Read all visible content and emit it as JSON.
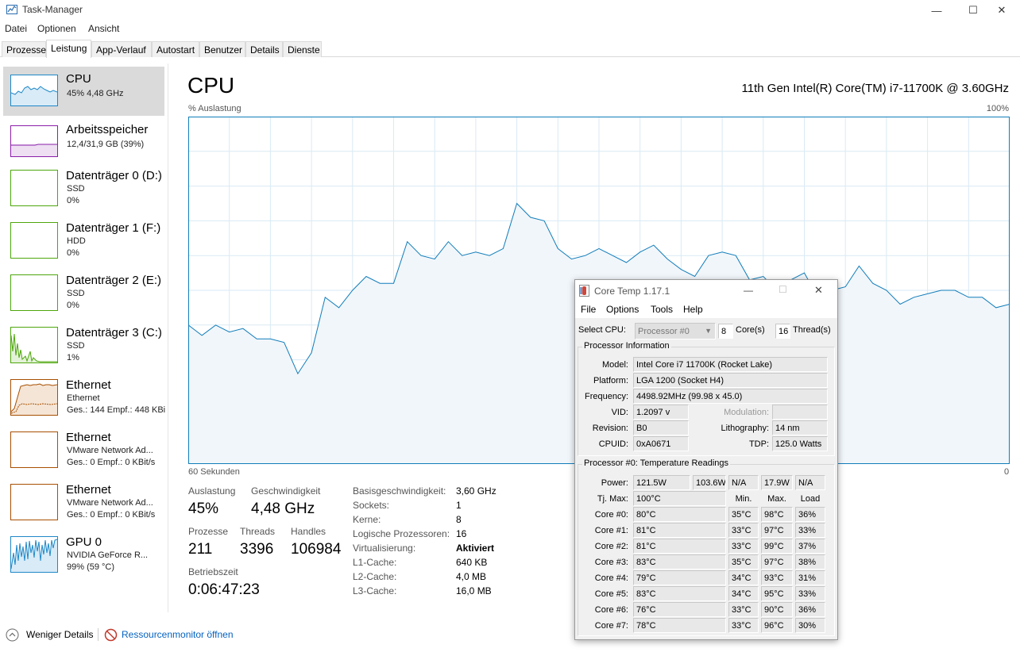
{
  "window": {
    "title": "Task-Manager",
    "minimize_glyph": "—",
    "maximize_glyph": "☐",
    "close_glyph": "✕"
  },
  "menubar": [
    "Datei",
    "Optionen",
    "Ansicht"
  ],
  "tabs": [
    "Prozesse",
    "Leistung",
    "App-Verlauf",
    "Autostart",
    "Benutzer",
    "Details",
    "Dienste"
  ],
  "active_tab": "Leistung",
  "sidebar": [
    {
      "title": "CPU",
      "sub1": "45% 4,48 GHz",
      "sub2": "",
      "color": "#1e88c7",
      "icon": "cpu-graph-icon"
    },
    {
      "title": "Arbeitsspeicher",
      "sub1": "12,4/31,9 GB (39%)",
      "sub2": "",
      "color": "#8b1fa9",
      "icon": "memory-graph-icon"
    },
    {
      "title": "Datenträger 0 (D:)",
      "sub1": "SSD",
      "sub2": "0%",
      "color": "#4da60c",
      "icon": "disk-graph-icon"
    },
    {
      "title": "Datenträger 1 (F:)",
      "sub1": "HDD",
      "sub2": "0%",
      "color": "#4da60c",
      "icon": "disk-graph-icon"
    },
    {
      "title": "Datenträger 2 (E:)",
      "sub1": "SSD",
      "sub2": "0%",
      "color": "#4da60c",
      "icon": "disk-graph-icon"
    },
    {
      "title": "Datenträger 3 (C:)",
      "sub1": "SSD",
      "sub2": "1%",
      "color": "#4da60c",
      "icon": "disk-graph-icon"
    },
    {
      "title": "Ethernet",
      "sub1": "Ethernet",
      "sub2": "Ges.: 144 Empf.: 448 KBi",
      "color": "#a74f01",
      "icon": "network-graph-icon"
    },
    {
      "title": "Ethernet",
      "sub1": "VMware Network Ad...",
      "sub2": "Ges.: 0 Empf.: 0 KBit/s",
      "color": "#a74f01",
      "icon": "network-graph-icon"
    },
    {
      "title": "Ethernet",
      "sub1": "VMware Network Ad...",
      "sub2": "Ges.: 0 Empf.: 0 KBit/s",
      "color": "#a74f01",
      "icon": "network-graph-icon"
    },
    {
      "title": "GPU 0",
      "sub1": "NVIDIA GeForce R...",
      "sub2": "99% (59 °C)",
      "color": "#1e88c7",
      "icon": "gpu-graph-icon"
    }
  ],
  "main": {
    "title": "CPU",
    "model": "11th Gen Intel(R) Core(TM) i7-11700K @ 3.60GHz",
    "y_label": "% Auslastung",
    "y_max_label": "100%",
    "x_left_label": "60 Sekunden",
    "x_right_label": "0",
    "stats": {
      "auslastung_label": "Auslastung",
      "auslastung": "45%",
      "geschw_label": "Geschwindigkeit",
      "geschw": "4,48 GHz",
      "prozesse_label": "Prozesse",
      "prozesse": "211",
      "threads_label": "Threads",
      "threads": "3396",
      "handles_label": "Handles",
      "handles": "106984",
      "betrieb_label": "Betriebszeit",
      "betrieb": "0:06:47:23"
    },
    "details": [
      {
        "k": "Basisgeschwindigkeit:",
        "v": "3,60 GHz"
      },
      {
        "k": "Sockets:",
        "v": "1"
      },
      {
        "k": "Kerne:",
        "v": "8"
      },
      {
        "k": "Logische Prozessoren:",
        "v": "16"
      },
      {
        "k": "Virtualisierung:",
        "v": "Aktiviert",
        "bold": true
      },
      {
        "k": "L1-Cache:",
        "v": "640 KB"
      },
      {
        "k": "L2-Cache:",
        "v": "4,0 MB"
      },
      {
        "k": "L3-Cache:",
        "v": "16,0 MB"
      }
    ]
  },
  "chart_data": {
    "type": "area",
    "title": "",
    "xlabel": "60 Sekunden",
    "ylabel": "% Auslastung",
    "xlim": [
      60,
      0
    ],
    "ylim": [
      0,
      100
    ],
    "grid": true,
    "series": [
      {
        "x": [
          60,
          59,
          58,
          57,
          56,
          55,
          54,
          53,
          52,
          51,
          50,
          49,
          48,
          47,
          46,
          45,
          44,
          43,
          42,
          41,
          40,
          39,
          38,
          37,
          36,
          35,
          34,
          33,
          32,
          31,
          30,
          29,
          28,
          27,
          26,
          25,
          24,
          23,
          22,
          21,
          20,
          19,
          18,
          17,
          16,
          15,
          14,
          13,
          12,
          11,
          10,
          9,
          8,
          7,
          6,
          5,
          4,
          3,
          2,
          1,
          0
        ],
        "y": [
          40,
          37,
          40,
          38,
          39,
          36,
          36,
          35,
          26,
          32,
          48,
          45,
          50,
          54,
          52,
          52,
          64,
          60,
          59,
          64,
          60,
          61,
          60,
          62,
          75,
          71,
          70,
          62,
          59,
          60,
          62,
          60,
          58,
          61,
          63,
          59,
          56,
          54,
          60,
          61,
          60,
          53,
          54,
          50,
          53,
          55,
          48,
          50,
          51,
          57,
          52,
          50,
          46,
          48,
          49,
          50,
          50,
          48,
          48,
          45,
          46
        ]
      }
    ],
    "color": "#117dbb"
  },
  "footer": {
    "less_details": "Weniger Details",
    "resmon": "Ressourcenmonitor öffnen"
  },
  "coretemp": {
    "title": "Core Temp 1.17.1",
    "menu": [
      "File",
      "Options",
      "Tools",
      "Help"
    ],
    "select_cpu_label": "Select CPU:",
    "select_cpu_value": "Processor #0",
    "cores_value": "8",
    "cores_label": "Core(s)",
    "threads_value": "16",
    "threads_label": "Thread(s)",
    "proc_info_title": "Processor Information",
    "model_label": "Model:",
    "model": "Intel Core i7 11700K (Rocket Lake)",
    "platform_label": "Platform:",
    "platform": "LGA 1200 (Socket H4)",
    "frequency_label": "Frequency:",
    "frequency": "4498.92MHz (99.98 x 45.0)",
    "vid_label": "VID:",
    "vid": "1.2097 v",
    "modulation_label": "Modulation:",
    "modulation": "",
    "revision_label": "Revision:",
    "revision": "B0",
    "lithography_label": "Lithography:",
    "lithography": "14 nm",
    "cpuid_label": "CPUID:",
    "cpuid": "0xA0671",
    "tdp_label": "TDP:",
    "tdp": "125.0 Watts",
    "temps_title": "Processor #0: Temperature Readings",
    "power_label": "Power:",
    "power": [
      "121.5W",
      "103.6W",
      "N/A",
      "17.9W",
      "N/A"
    ],
    "tjmax_label": "Tj. Max:",
    "tjmax": "100°C",
    "min_label": "Min.",
    "max_label": "Max.",
    "load_label": "Load",
    "cores": [
      {
        "name": "Core #0:",
        "temp": "80°C",
        "min": "35°C",
        "max": "98°C",
        "load": "36%"
      },
      {
        "name": "Core #1:",
        "temp": "81°C",
        "min": "33°C",
        "max": "97°C",
        "load": "33%"
      },
      {
        "name": "Core #2:",
        "temp": "81°C",
        "min": "33°C",
        "max": "99°C",
        "load": "37%"
      },
      {
        "name": "Core #3:",
        "temp": "83°C",
        "min": "35°C",
        "max": "97°C",
        "load": "38%"
      },
      {
        "name": "Core #4:",
        "temp": "79°C",
        "min": "34°C",
        "max": "93°C",
        "load": "31%"
      },
      {
        "name": "Core #5:",
        "temp": "83°C",
        "min": "34°C",
        "max": "95°C",
        "load": "33%"
      },
      {
        "name": "Core #6:",
        "temp": "76°C",
        "min": "33°C",
        "max": "90°C",
        "load": "36%"
      },
      {
        "name": "Core #7:",
        "temp": "78°C",
        "min": "33°C",
        "max": "96°C",
        "load": "30%"
      }
    ]
  }
}
